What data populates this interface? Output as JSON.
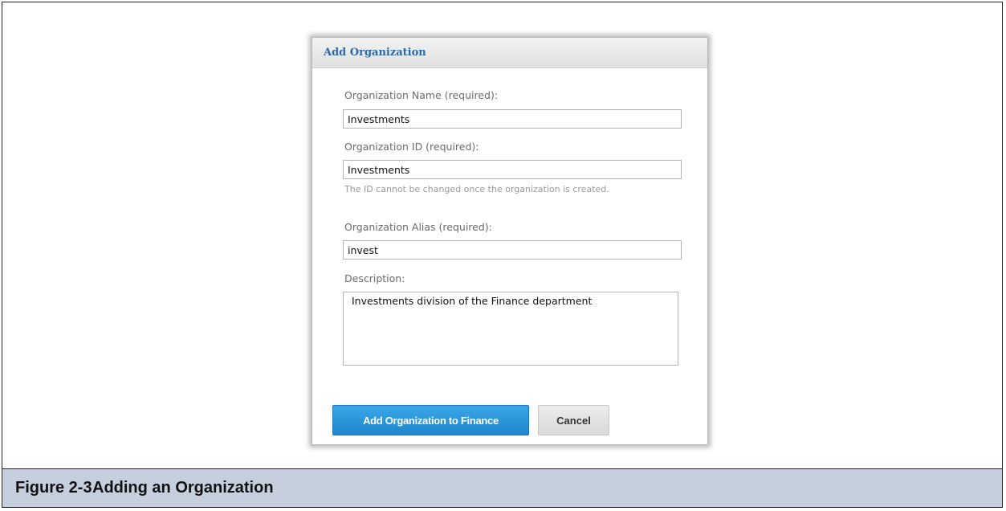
{
  "dialog": {
    "title": "Add Organization",
    "name_label": "Organization Name (required):",
    "name_value": "Investments",
    "id_label": "Organization ID (required):",
    "id_value": "Investments",
    "id_hint": "The ID cannot be changed once the organization is created.",
    "alias_label": "Organization Alias (required):",
    "alias_value": "invest",
    "description_label": "Description:",
    "description_value": "Investments division of the Finance department",
    "submit_label": "Add Organization to Finance",
    "cancel_label": "Cancel"
  },
  "caption": {
    "number": "Figure 2-3",
    "title": "Adding an Organization"
  }
}
